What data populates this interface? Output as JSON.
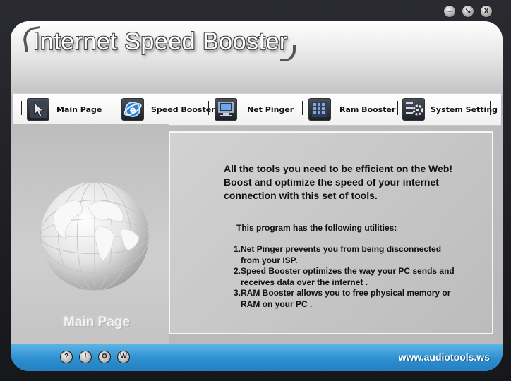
{
  "window": {
    "controls": {
      "minimize": "–",
      "restore": "↘",
      "close": "X"
    }
  },
  "header": {
    "title": "Internet Speed Booster"
  },
  "nav": {
    "items": [
      {
        "label": "Main Page",
        "icon": "cursor-icon"
      },
      {
        "label": "Speed Booster",
        "icon": "ie-logo-icon"
      },
      {
        "label": "Net Pinger",
        "icon": "computer-icon"
      },
      {
        "label": "Ram Booster",
        "icon": "ram-chip-icon"
      },
      {
        "label": "System Setting",
        "icon": "gears-icon"
      }
    ]
  },
  "left": {
    "caption": "Main Page"
  },
  "content": {
    "intro": "All the tools you need to be efficient on the Web! Boost and optimize the speed of your internet connection with this set of tools.",
    "heading": "This program has the following utilities:",
    "utilities": [
      {
        "num": "1.",
        "text": "Net Pinger prevents you from being disconnected from your ISP."
      },
      {
        "num": "2.",
        "text": "Speed Booster optimizes the way your PC sends and receives data over the internet ."
      },
      {
        "num": "3.",
        "text": "RAM Booster allows you to free physical memory or RAM on your PC ."
      }
    ]
  },
  "footer": {
    "buttons": {
      "help": "?",
      "info": "!",
      "settings": "⚙",
      "web": "W"
    },
    "site": "www.audiotools.ws"
  },
  "colors": {
    "accent": "#2c8fd0",
    "panel": "#bdbdbd"
  }
}
